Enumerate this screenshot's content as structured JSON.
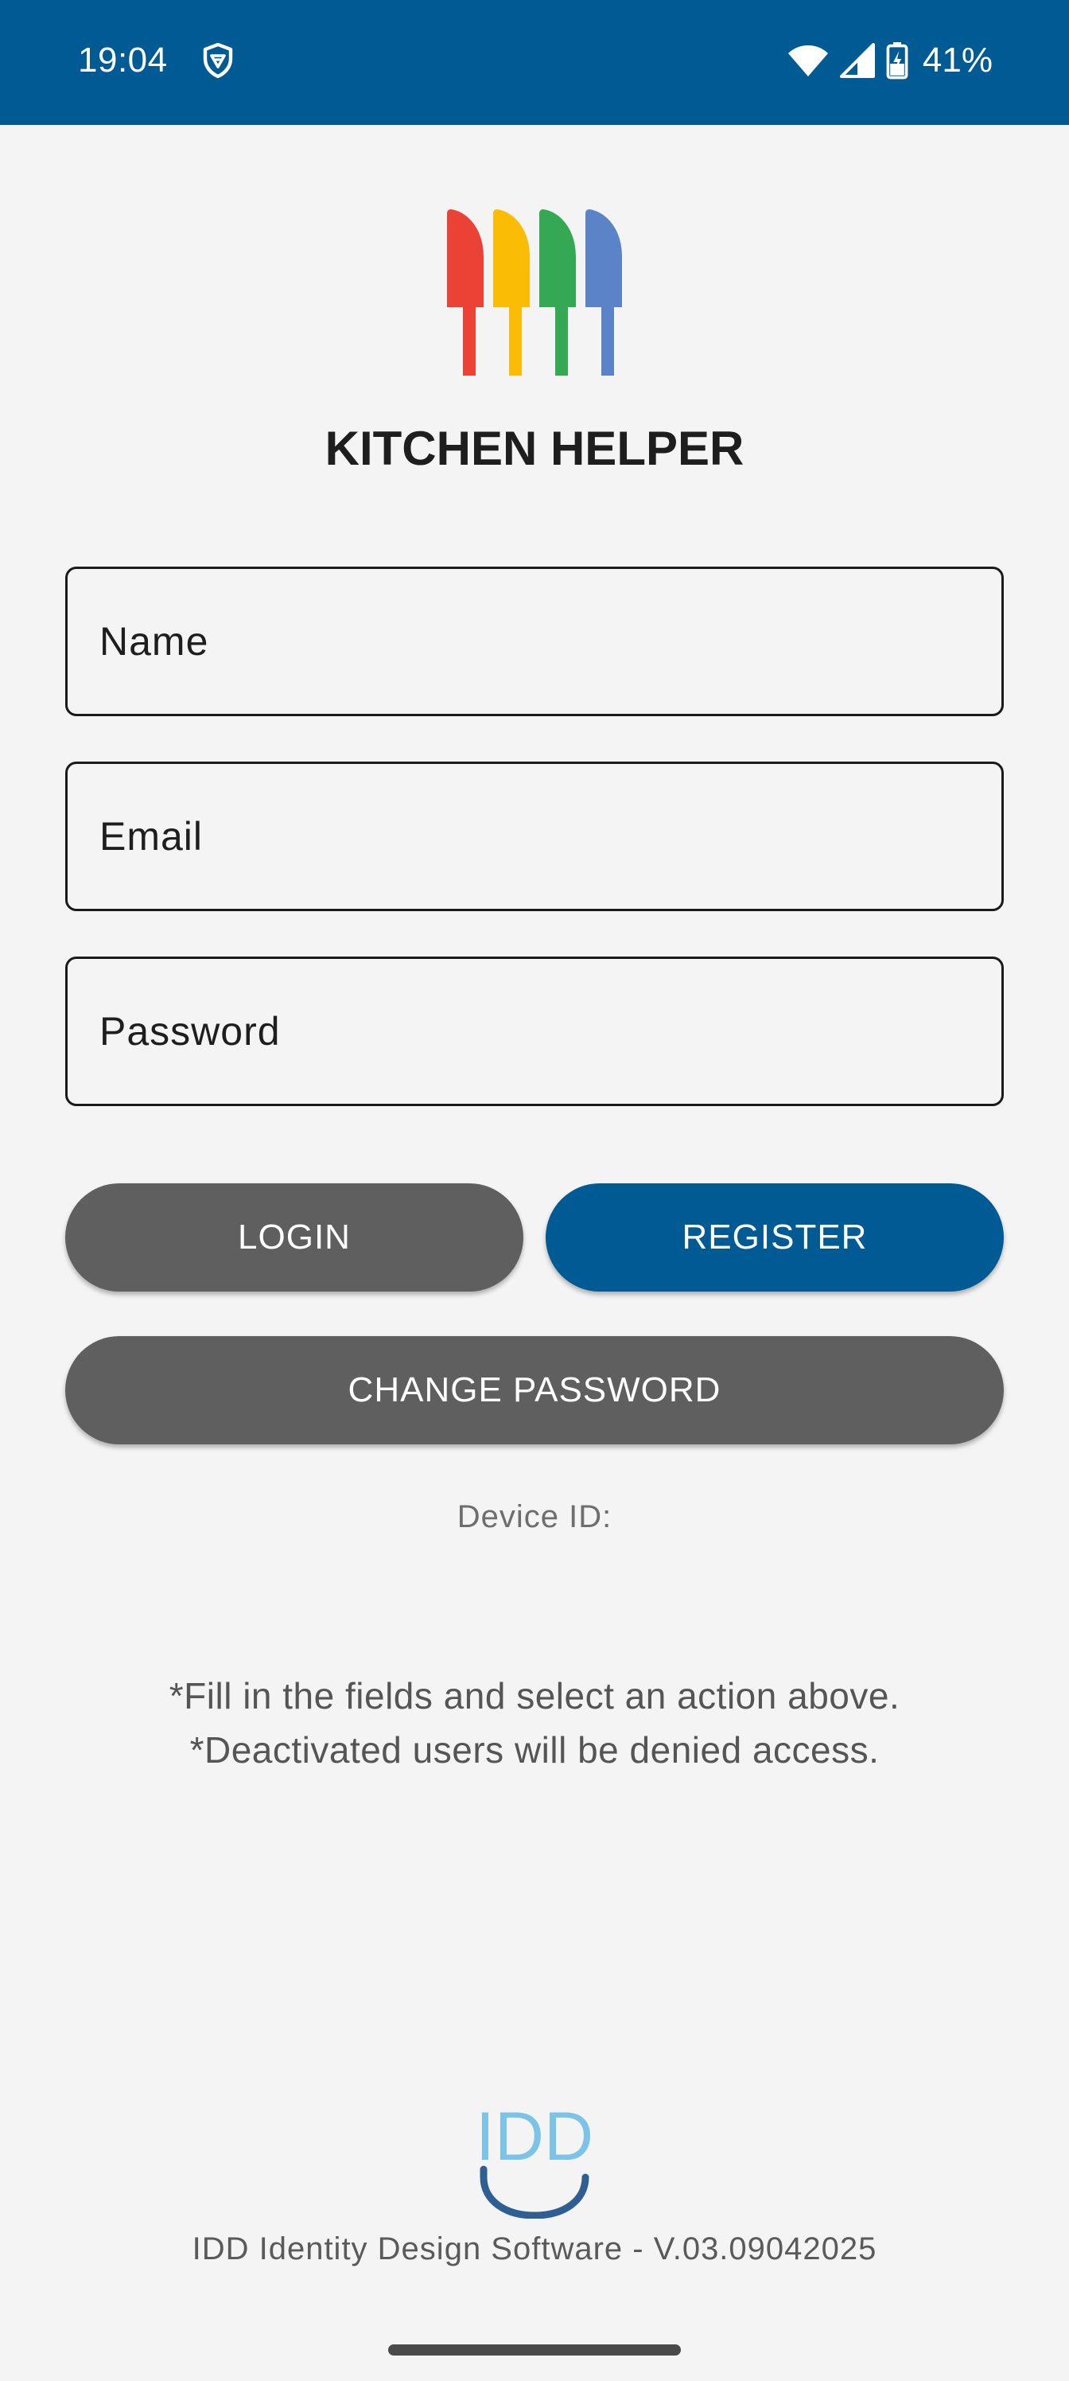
{
  "status_bar": {
    "time": "19:04",
    "battery": "41%",
    "icons": [
      "vpn-shield-icon",
      "wifi-icon",
      "cell-signal-icon",
      "battery-charging-icon"
    ],
    "background_color": "#005a93"
  },
  "app": {
    "title": "KITCHEN HELPER",
    "logo_icon": "kitchen-utensils-logo",
    "logo_colors": [
      "#ea4335",
      "#fbbc05",
      "#34a853",
      "#5b83c7"
    ]
  },
  "form": {
    "name_label": "Name",
    "email_label": "Email",
    "password_label": "Password"
  },
  "buttons": {
    "login": "LOGIN",
    "register": "REGISTER",
    "change_password": "CHANGE PASSWORD",
    "primary_color": "#005a93",
    "secondary_color": "#5f5f5f"
  },
  "device_id_label": "Device ID:",
  "hints": {
    "line1": "*Fill in the fields and select an action above.",
    "line2": "*Deactivated users will be denied access."
  },
  "footer": {
    "logo_text": "IDD",
    "text": "IDD Identity Design Software - V.03.09042025"
  }
}
